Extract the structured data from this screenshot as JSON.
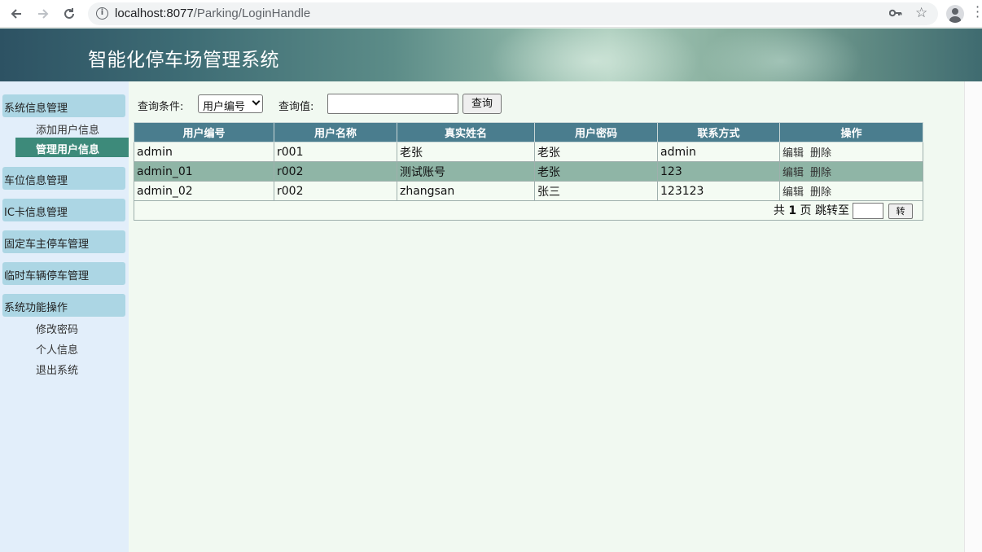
{
  "browser": {
    "url_host": "localhost:8077",
    "url_path": "/Parking/LoginHandle",
    "icons": [
      "back-arrow-icon",
      "forward-arrow-icon",
      "reload-icon",
      "info-icon",
      "key-icon",
      "star-icon",
      "avatar-icon",
      "more-menu-icon"
    ]
  },
  "header": {
    "title": "智能化停车场管理系统"
  },
  "sidebar": {
    "groups": [
      {
        "label": "系统信息管理",
        "items": [
          "添加用户信息",
          "管理用户信息"
        ],
        "active_item": "管理用户信息"
      },
      {
        "label": "车位信息管理",
        "items": []
      },
      {
        "label": "IC卡信息管理",
        "items": []
      },
      {
        "label": "固定车主停车管理",
        "items": []
      },
      {
        "label": "临时车辆停车管理",
        "items": []
      },
      {
        "label": "系统功能操作",
        "items": [
          "修改密码",
          "个人信息",
          "退出系统"
        ]
      }
    ]
  },
  "query": {
    "condition_label": "查询条件:",
    "condition_selected": "用户编号",
    "value_label": "查询值:",
    "value_input": "",
    "button_label": "查询"
  },
  "table": {
    "headers": [
      "用户编号",
      "用户名称",
      "真实姓名",
      "用户密码",
      "联系方式",
      "操作"
    ],
    "rows": [
      {
        "id": "admin",
        "name": "r001",
        "real_name": "老张",
        "password": "老张",
        "contact": "admin",
        "edit": "编辑",
        "delete": "删除"
      },
      {
        "id": "admin_01",
        "name": "r002",
        "real_name": "测试账号",
        "password": "老张",
        "contact": "123",
        "edit": "编辑",
        "delete": "删除"
      },
      {
        "id": "admin_02",
        "name": "r002",
        "real_name": "zhangsan",
        "password": "张三",
        "contact": "123123",
        "edit": "编辑",
        "delete": "删除"
      }
    ],
    "highlighted_row": 1
  },
  "pager": {
    "total_prefix": "共",
    "total_pages": "1",
    "page_unit": "页",
    "jump_label": "跳转至",
    "jump_input": "",
    "go_button": "转"
  },
  "colors": {
    "table_header": "#4a7d8e",
    "row_highlight": "#8fb5a6",
    "sidebar_group": "#acd6e4",
    "active_item": "#3d8a7a"
  }
}
